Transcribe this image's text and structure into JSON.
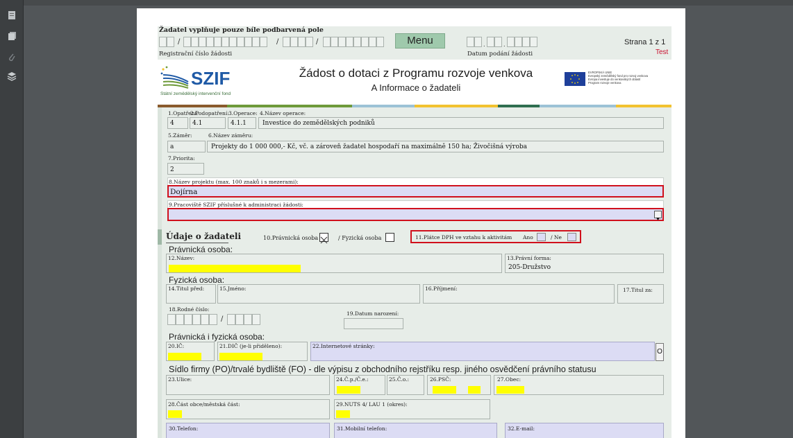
{
  "viewer": {
    "tools": [
      "pages-icon",
      "copy-icon",
      "attachment-icon",
      "layers-icon"
    ]
  },
  "header": {
    "instruction": "Žadatel vyplňuje pouze bíle podbarvená pole",
    "menu_label": "Menu",
    "reg_label": "Registrační číslo žádosti",
    "date_label": "Datum podání žádosti",
    "page_info": "Strana 1 z 1",
    "test_label": "Test",
    "slash": "/"
  },
  "org": {
    "name": "SZIF",
    "subtitle": "Státní zemědělský intervenční fond",
    "title": "Žádost o dotaci z Programu rozvoje venkova",
    "section": "A Informace o žadateli",
    "eu_text": "EVROPSKÁ UNIE\nEvropský zemědělský fond pro rozvoj venkova\nEvropa investuje do venkovských oblastí\nProgram rozvoje venkova"
  },
  "fields": {
    "f1_label": "1.Opatření:",
    "f1_value": "4",
    "f2_label": "2.Podopatření:",
    "f2_value": "4.1",
    "f3_label": "3.Operace:",
    "f3_value": "4.1.1",
    "f4_label": "4.Název operace:",
    "f4_value": "Investice do zemědělských podniků",
    "f5_label": "5.Záměr:",
    "f5_value": "a",
    "f6_label": "6.Název záměru:",
    "f6_value": "Projekty do 1 000 000,- Kč, vč. a zároveň žadatel hospodaří na maximálně 150 ha; Živočišná výroba",
    "f7_label": "7.Priorita:",
    "f7_value": "2",
    "f8_label": "8.Název projektu (max. 100 znaků i s mezerami):",
    "f8_value": "Dojírna",
    "f9_label": "9.Pracoviště SZIF příslušné k administraci žádosti:",
    "f9_value": ""
  },
  "applicant": {
    "heading": "Údaje o žadateli",
    "f10_label": "10.Právnická osoba",
    "fyz_label": "/ Fyzická osoba",
    "f11_label": "11.Plátce DPH ve vztahu k aktivitám",
    "ano": "Ano",
    "ne": "/ Ne",
    "pravnicka_heading": "Právnická osoba:",
    "f12_label": "12.Název:",
    "f13_label": "13.Právní forma:",
    "f13_value": "205-Družstvo",
    "fyzicka_heading": "Fyzická osoba:",
    "f14_label": "14.Titul před:",
    "f15_label": "15.Jméno:",
    "f16_label": "16.Příjmení:",
    "f17_label": "17.Titul za:",
    "f18_label": "18.Rodné číslo:",
    "f18_slash": "/",
    "f19_label": "19.Datum narození:",
    "both_heading": "Právnická i fyzická osoba:",
    "f20_label": "20.IČ:",
    "f21_label": "21.DIČ (je-li přiděleno):",
    "f22_label": "22.Internetové stránky:",
    "f22_btn": "O"
  },
  "address": {
    "heading": "Sídlo firmy (PO)/trvalé bydliště (FO) - dle výpisu z obchodního rejstříku resp. jiného osvědčení právního statusu",
    "f23_label": "23.Ulice:",
    "f24_label": "24.Č.p./Č.e.:",
    "f25_label": "25.Č.o.:",
    "f26_label": "26.PSČ:",
    "f27_label": "27.Obec:",
    "f28_label": "28.Část obce/městská část:",
    "f29_label": "29.NUTS 4/ LAU 1 (okres):",
    "f30_label": "30.Telefon:",
    "f31_label": "31.Mobilní telefon:",
    "f32_label": "32.E-mail:"
  },
  "colors": {
    "required_fill": "#ffff00",
    "alert_border": "#d0101c",
    "szif_blue": "#1f5aa6",
    "eu_blue": "#1e3f9a",
    "strips": [
      "#8a5a2c",
      "#6e9a3a",
      "#f2c230",
      "#2f6e50",
      "#9cc2d6"
    ]
  }
}
